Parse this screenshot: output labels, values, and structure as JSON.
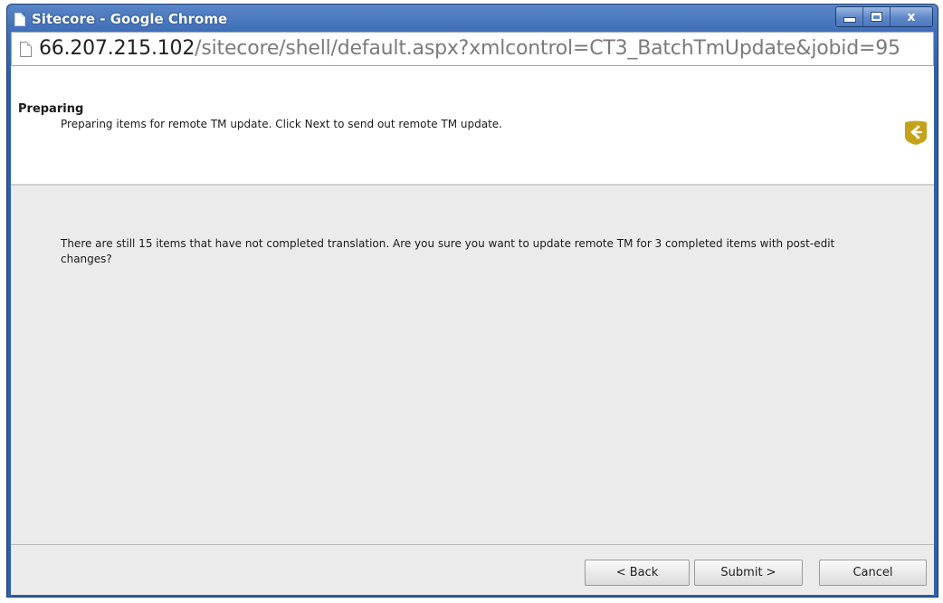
{
  "window": {
    "title": "Sitecore - Google Chrome",
    "controls": {
      "minimize": "",
      "maximize": "",
      "close": "x"
    }
  },
  "address_bar": {
    "host": "66.207.215.102",
    "path": "/sitecore/shell/default.aspx?xmlcontrol=CT3_BatchTmUpdate&jobid=95"
  },
  "dialog": {
    "header_title": "Preparing",
    "header_description": "Preparing items for remote TM update. Click Next to send out remote TM update.",
    "message": "There are still 15 items that have not completed translation. Are you sure you want to update remote TM for 3 completed items with post-edit changes?",
    "buttons": {
      "back": "< Back",
      "submit": "Submit >",
      "cancel": "Cancel"
    }
  },
  "icons": {
    "window": "page-icon",
    "address": "blank-page-icon",
    "logo": "sitecore-logo-icon"
  },
  "colors": {
    "titlebar": "#3f6fb8",
    "logo": "#c6a21a",
    "content_bg": "#ebebeb"
  }
}
